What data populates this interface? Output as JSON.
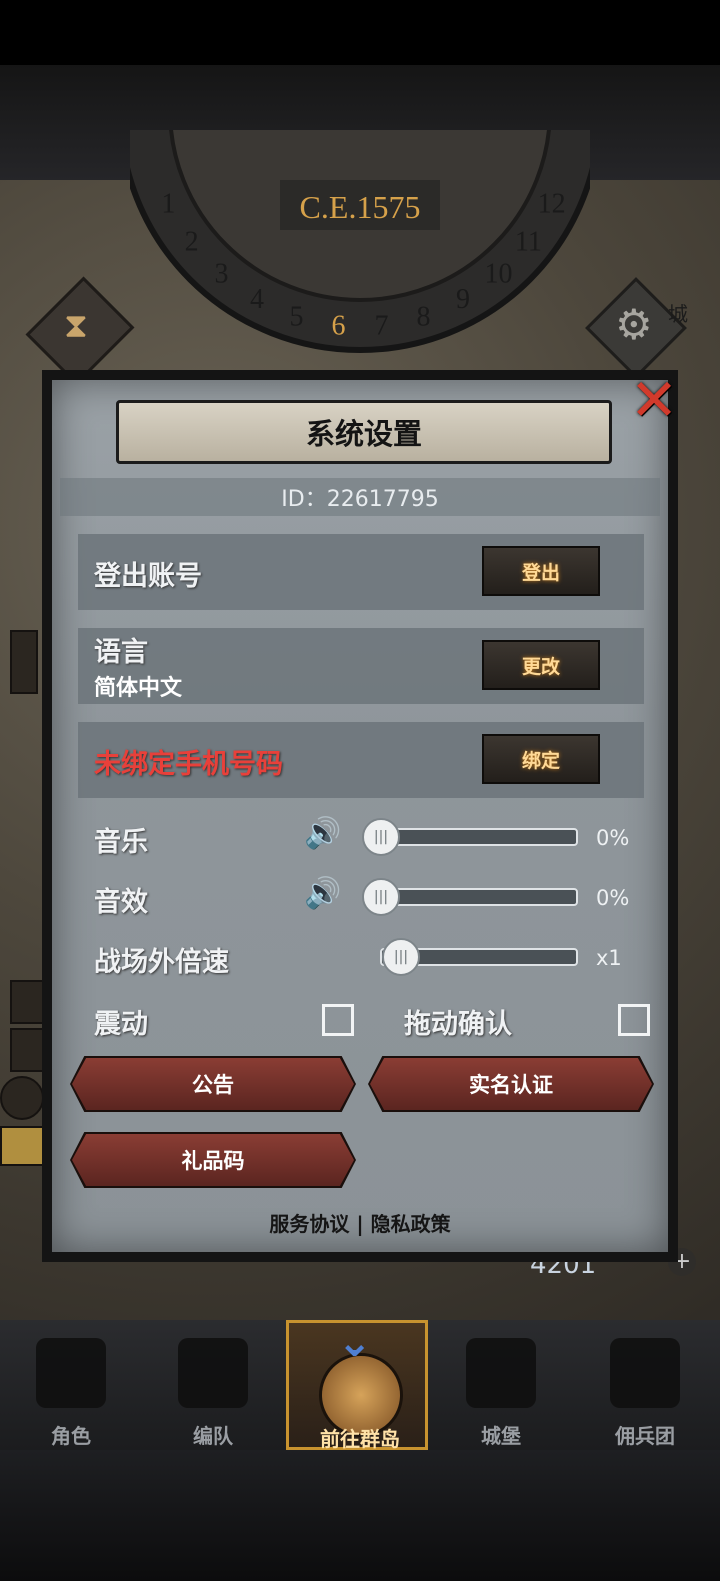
{
  "era": {
    "year": "C.E.1575",
    "dial_numbers": [
      "1",
      "2",
      "3",
      "4",
      "5",
      "6",
      "7",
      "8",
      "9",
      "10",
      "11",
      "12"
    ],
    "current": "6"
  },
  "map": {
    "city_label": "城",
    "resource_count": "4201"
  },
  "modal": {
    "title": "系统设置",
    "id_text": "ID：22617795",
    "logout": {
      "label": "登出账号",
      "button": "登出"
    },
    "language": {
      "label": "语言",
      "value": "简体中文",
      "button": "更改"
    },
    "phone": {
      "label": "未绑定手机号码",
      "button": "绑定"
    },
    "music": {
      "label": "音乐",
      "value": "0%",
      "level": 0
    },
    "sfx": {
      "label": "音效",
      "value": "0%",
      "level": 0
    },
    "speed": {
      "label": "战场外倍速",
      "value": "x1"
    },
    "vibration": {
      "label": "震动",
      "checked": false
    },
    "drag_confirm": {
      "label": "拖动确认",
      "checked": false
    },
    "buttons": {
      "announcement": "公告",
      "realname": "实名认证",
      "gift_code": "礼品码"
    },
    "footer": {
      "terms": "服务协议",
      "separator": "|",
      "privacy": "隐私政策"
    }
  },
  "nav": [
    {
      "label": "角色"
    },
    {
      "label": "编队"
    },
    {
      "label": "前往群岛",
      "active": true
    },
    {
      "label": "城堡"
    },
    {
      "label": "佣兵团"
    }
  ]
}
